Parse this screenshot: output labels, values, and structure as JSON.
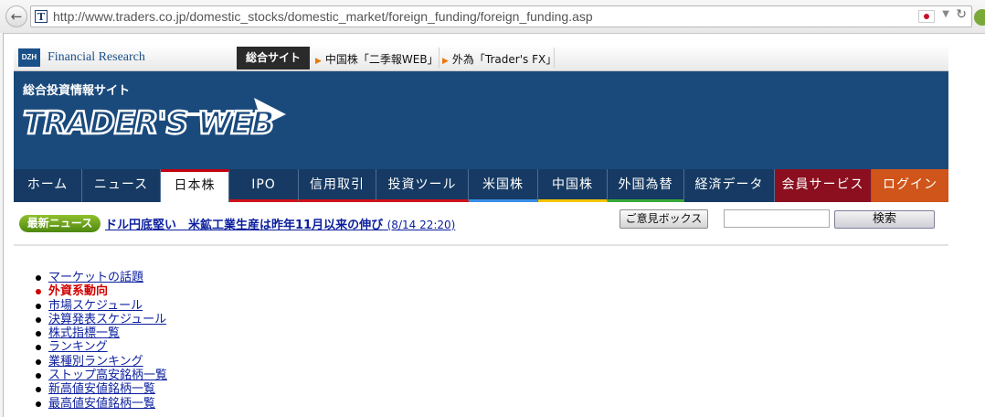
{
  "browser": {
    "url": "http://www.traders.co.jp/domestic_stocks/domestic_market/foreign_funding/foreign_funding.asp",
    "site_icon": "T"
  },
  "topbar": {
    "logo_text": "DZH",
    "company": "Financial Research",
    "sogo": "総合サイト",
    "links": [
      "中国株「二季報WEB」",
      "外為「Trader's FX」"
    ]
  },
  "banner": {
    "subtitle": "総合投資情報サイト",
    "logo": "TRADER'S WEB"
  },
  "nav": {
    "items": [
      {
        "label": "ホーム",
        "accent": ""
      },
      {
        "label": "ニュース",
        "accent": ""
      },
      {
        "label": "日本株",
        "accent": "#c3000f"
      },
      {
        "label": "IPO",
        "accent": "#d0121b"
      },
      {
        "label": "信用取引",
        "accent": "#d0121b"
      },
      {
        "label": "投資ツール",
        "accent": "#d0121b"
      },
      {
        "label": "米国株",
        "accent": "#3a8ee6"
      },
      {
        "label": "中国株",
        "accent": "#f2c500"
      },
      {
        "label": "外国為替",
        "accent": "#39a83a"
      },
      {
        "label": "経済データ",
        "accent": ""
      },
      {
        "label": "会員サービス",
        "accent": ""
      },
      {
        "label": "ログイン",
        "accent": ""
      }
    ]
  },
  "news": {
    "badge": "最新ニュース",
    "headline": "ドル円底堅い　米鉱工業生産は昨年11月以来の伸び",
    "time": "(8/14 22:20)"
  },
  "search": {
    "opinion_label": "ご意見ボックス",
    "button_label": "検索",
    "value": ""
  },
  "menu": {
    "items": [
      {
        "label": "マーケットの話題",
        "current": false
      },
      {
        "label": "外資系動向",
        "current": true
      },
      {
        "label": "市場スケジュール",
        "current": false
      },
      {
        "label": "決算発表スケジュール",
        "current": false
      },
      {
        "label": "株式指標一覧",
        "current": false
      },
      {
        "label": "ランキング",
        "current": false
      },
      {
        "label": "業種別ランキング",
        "current": false
      },
      {
        "label": "ストップ高安銘柄一覧",
        "current": false
      },
      {
        "label": "新高値安値銘柄一覧",
        "current": false
      },
      {
        "label": "最高値安値銘柄一覧",
        "current": false
      }
    ]
  },
  "colors": {
    "banner": "#1a4a7c",
    "nav": "#163a63",
    "member": "#8b0f1f",
    "login": "#d0551a",
    "link": "#0b1f9e",
    "current": "#d10000"
  }
}
